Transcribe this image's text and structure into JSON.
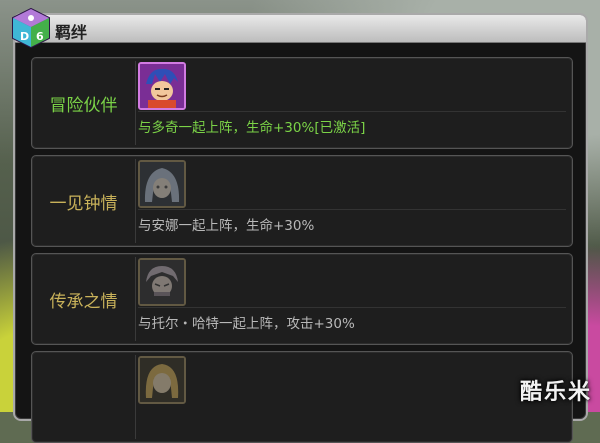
{
  "window": {
    "title": "羁绊"
  },
  "bonds": [
    {
      "label": "冒险伙伴",
      "description": "与多奇一起上阵，生命+30%[已激活]",
      "active": true,
      "avatar_icon": "hero-avatar-icon"
    },
    {
      "label": "一见钟情",
      "description": "与安娜一起上阵，生命+30%",
      "active": false,
      "avatar_icon": "anna-avatar-icon"
    },
    {
      "label": "传承之情",
      "description": "与托尔・哈特一起上阵，攻击+30%",
      "active": false,
      "avatar_icon": "thor-hart-avatar-icon"
    },
    {
      "label": "",
      "description": "",
      "active": false,
      "avatar_icon": "partner-avatar-icon"
    }
  ],
  "watermark": "酷乐米",
  "colors": {
    "active_text": "#7bd347",
    "inactive_label": "#c9b25a",
    "inactive_desc": "#b8b8b8"
  }
}
